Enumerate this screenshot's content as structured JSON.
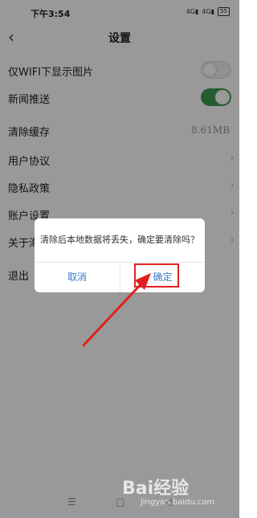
{
  "status_bar": {
    "time": "下午3:54",
    "network1": "4G",
    "network2": "4G",
    "battery": "55"
  },
  "header": {
    "title": "设置",
    "back_icon": "chevron-left-icon"
  },
  "settings": [
    {
      "label": "仅WIFI下显示图片",
      "control": "toggle",
      "state": "off"
    },
    {
      "label": "新闻推送",
      "control": "toggle",
      "state": "on"
    },
    {
      "label": "清除缓存",
      "value": "8.61MB"
    },
    {
      "label": "用户协议",
      "control": "chevron"
    },
    {
      "label": "隐私政策",
      "control": "chevron"
    },
    {
      "label": "账户设置",
      "control": "chevron"
    },
    {
      "label": "关于海",
      "control": "chevron"
    },
    {
      "label": "退出"
    }
  ],
  "dialog": {
    "message": "清除后本地数据将丢失，确定要清除吗？",
    "cancel_label": "取消",
    "confirm_label": "确定"
  },
  "nav_bar": {
    "menu": "☰",
    "home": "▢",
    "back": "◁"
  },
  "watermark": {
    "text": "Bai经验",
    "sub": "jingyan.baidu.com"
  },
  "colors": {
    "toggle_on": "#3e9b52",
    "dialog_button": "#3a7ad0",
    "highlight": "#e02020"
  }
}
